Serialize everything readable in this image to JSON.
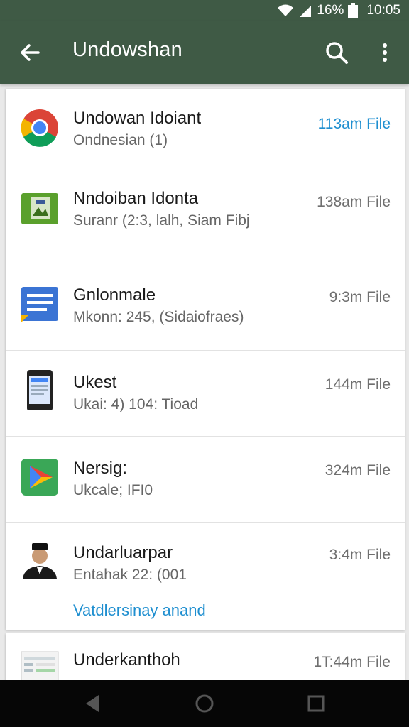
{
  "status": {
    "battery": "16%",
    "time": "10:05"
  },
  "toolbar": {
    "title": "Undowshan",
    "back_icon": "arrow-left-icon",
    "search_icon": "search-icon",
    "more_icon": "more-vert-icon"
  },
  "downloads": [
    {
      "title": "Undowan Idoiant",
      "subtitle": "Ondnesian (1)",
      "meta": "113am File",
      "meta_color": "#1f8fd0",
      "icon": "chrome-icon"
    },
    {
      "title": "Nndoiban Idonta",
      "subtitle": "Suranr (2:3, lalh, Siam Fibj",
      "meta": "138am File",
      "icon": "image-file-icon"
    },
    {
      "title": "Gnlonmale",
      "subtitle": "Mkonn: 245, (Sidaiofraes)",
      "meta": "9:3m File",
      "icon": "docs-icon"
    },
    {
      "title": "Ukest",
      "subtitle": "Ukai: 4) 104: Tioad",
      "meta": "144m File",
      "icon": "phone-icon"
    },
    {
      "title": "Nersig:",
      "subtitle": "Ukcale; IFI0",
      "meta": "324m File",
      "icon": "play-store-icon"
    },
    {
      "title": "Undarluarpar",
      "subtitle": "Entahak 22: (001",
      "meta": "3:4m File",
      "action": "Vatdlersinay anand",
      "icon": "avatar-icon"
    },
    {
      "title": "Underkanthoh",
      "subtitle": "",
      "meta": "1T:44m File",
      "icon": "sheet-icon"
    }
  ],
  "nav": {
    "back": "nav-back-icon",
    "home": "nav-home-icon",
    "recents": "nav-recents-icon"
  }
}
